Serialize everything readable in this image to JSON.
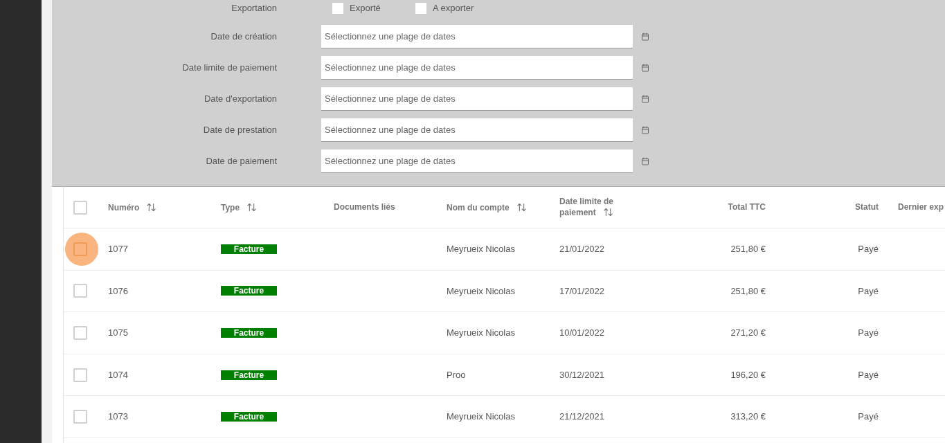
{
  "filters": {
    "export": {
      "label": "Exportation",
      "options": [
        {
          "label": "Exporté",
          "checked": false
        },
        {
          "label": "A exporter",
          "checked": false
        }
      ]
    },
    "date_ranges": [
      {
        "label": "Date de création",
        "placeholder": "Sélectionnez une plage de dates"
      },
      {
        "label": "Date limite de paiement",
        "placeholder": "Sélectionnez une plage de dates"
      },
      {
        "label": "Date d'exportation",
        "placeholder": "Sélectionnez une plage de dates"
      },
      {
        "label": "Date de prestation",
        "placeholder": "Sélectionnez une plage de dates"
      },
      {
        "label": "Date de paiement",
        "placeholder": "Sélectionnez une plage de dates"
      }
    ]
  },
  "table": {
    "select_all": {
      "checked": false
    },
    "columns": [
      {
        "label": "Numéro",
        "sortable": true
      },
      {
        "label": "Type",
        "sortable": true
      },
      {
        "label": "Documents liés",
        "sortable": false
      },
      {
        "label": "Nom du compte",
        "sortable": true
      },
      {
        "label": "Date limite de paiement",
        "sortable": true
      },
      {
        "label": "Total TTC",
        "sortable": false
      },
      {
        "label": "Statut",
        "sortable": false
      },
      {
        "label": "Dernier exp",
        "sortable": false
      }
    ],
    "rows": [
      {
        "checked": false,
        "focused": true,
        "number": "1077",
        "type": "Facture",
        "account": "Meyrueix Nicolas",
        "due_date": "21/01/2022",
        "total": "251,80 €",
        "status": "Payé"
      },
      {
        "checked": false,
        "focused": false,
        "number": "1076",
        "type": "Facture",
        "account": "Meyrueix Nicolas",
        "due_date": "17/01/2022",
        "total": "251,80 €",
        "status": "Payé"
      },
      {
        "checked": false,
        "focused": false,
        "number": "1075",
        "type": "Facture",
        "account": "Meyrueix Nicolas",
        "due_date": "10/01/2022",
        "total": "271,20 €",
        "status": "Payé"
      },
      {
        "checked": false,
        "focused": false,
        "number": "1074",
        "type": "Facture",
        "account": "Proo",
        "due_date": "30/12/2021",
        "total": "196,20 €",
        "status": "Payé"
      },
      {
        "checked": false,
        "focused": false,
        "number": "1073",
        "type": "Facture",
        "account": "Meyrueix Nicolas",
        "due_date": "21/12/2021",
        "total": "313,20 €",
        "status": "Payé"
      }
    ]
  }
}
